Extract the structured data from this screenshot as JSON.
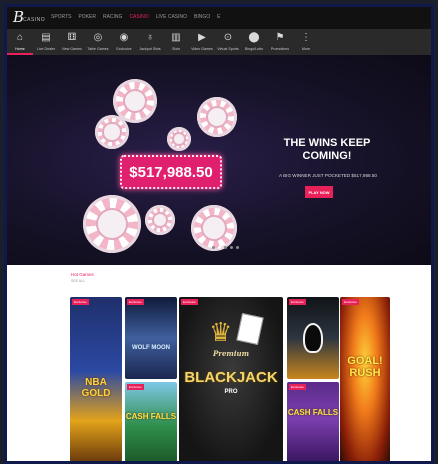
{
  "topbar": {
    "logo_letter": "B",
    "logo_word": "CASINO",
    "links": [
      "SPORTS",
      "POKER",
      "RACING",
      "CASINO",
      "LIVE CASINO",
      "BINGO",
      "E"
    ]
  },
  "nav": {
    "items": [
      {
        "label": "Home",
        "icon": "home-icon"
      },
      {
        "label": "Live Dealer",
        "icon": "cards-icon"
      },
      {
        "label": "New Games",
        "icon": "dice-icon"
      },
      {
        "label": "Table Games",
        "icon": "table-icon"
      },
      {
        "label": "Exclusive",
        "icon": "target-icon"
      },
      {
        "label": "Jackpot Slots",
        "icon": "money-bag-icon"
      },
      {
        "label": "Slots",
        "icon": "slot-machine-icon"
      },
      {
        "label": "Video Games",
        "icon": "play-icon"
      },
      {
        "label": "Virtual Sports",
        "icon": "circle-target-icon"
      },
      {
        "label": "Bingo/Lotto",
        "icon": "location-pin-icon"
      },
      {
        "label": "Promotions",
        "icon": "megaphone-icon"
      },
      {
        "label": "More",
        "icon": "more-icon"
      }
    ]
  },
  "hero": {
    "amount": "$517,988.50",
    "headline": "THE WINS KEEP COMING!",
    "subline": "A BIG WINNER JUST POCKETED $517,988.50",
    "cta": "PLAY NOW"
  },
  "section": {
    "title": "Hot Games",
    "subtitle": "SEE ALL"
  },
  "games": [
    {
      "badge": "Exclusive",
      "title": "NBA GOLD"
    },
    {
      "badge": "Exclusive",
      "title": "WOLF MOON"
    },
    {
      "badge": "Exclusive",
      "title": "CASH FALLS"
    },
    {
      "badge": "Exclusive",
      "title": "BLACKJACK",
      "subtitle": "Premium",
      "tag": "PRO"
    },
    {
      "badge": "Exclusive",
      "title": ""
    },
    {
      "badge": "Exclusive",
      "title": "CASH FALLS"
    },
    {
      "badge": "Exclusive",
      "title": "GOAL! RUSH"
    }
  ],
  "colors": {
    "accent": "#e8215a",
    "nav_bg": "#2a2a2a",
    "topbar_bg": "#111111"
  }
}
